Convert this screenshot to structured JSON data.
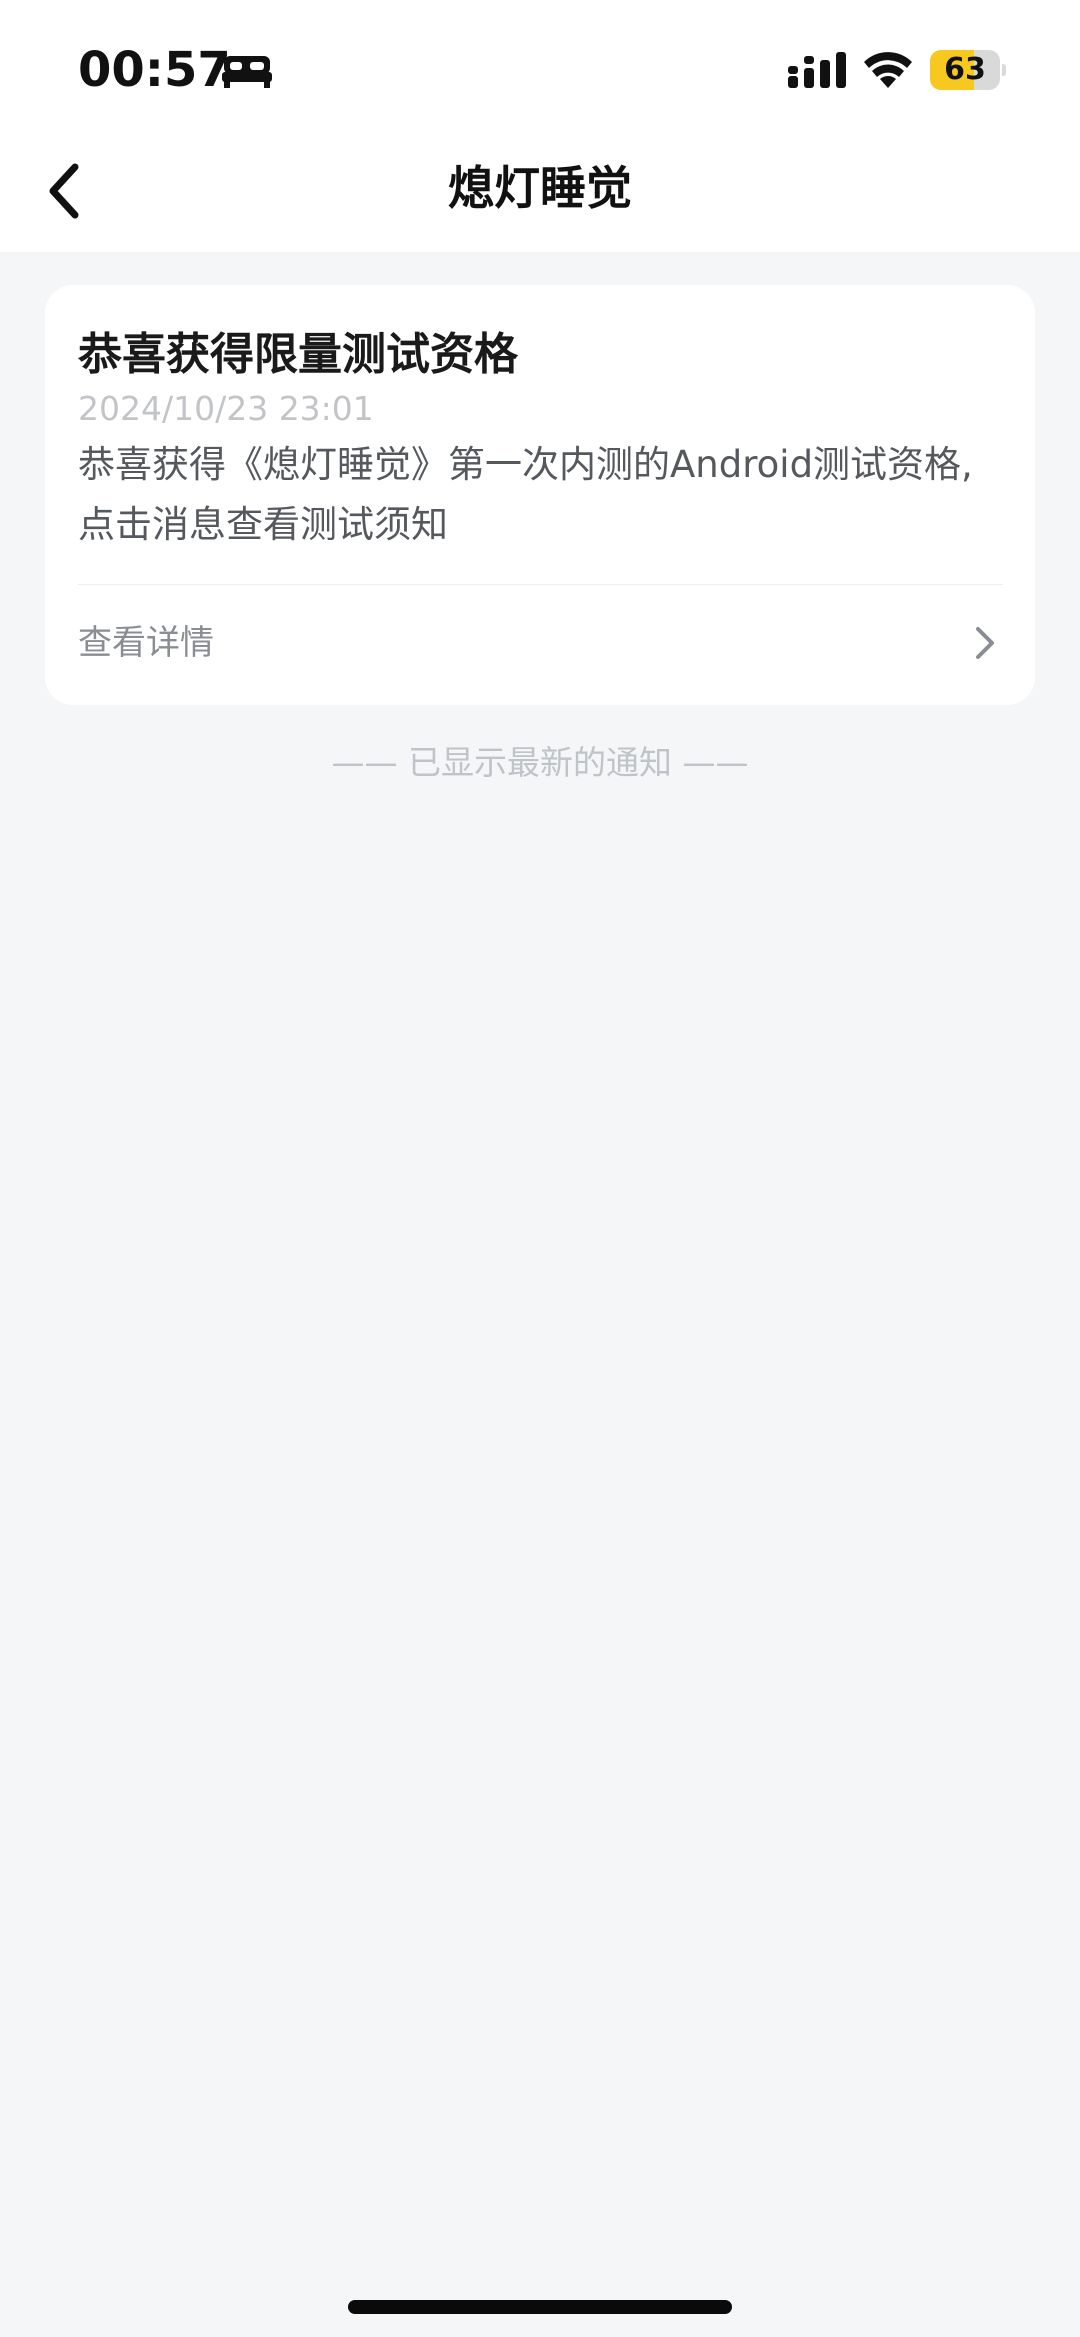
{
  "status_bar": {
    "time": "00:57",
    "battery_level": "63",
    "battery_fraction": 0.63,
    "icons": [
      "bed-icon",
      "signal-icon",
      "wifi-icon",
      "battery-icon"
    ]
  },
  "header": {
    "title": "熄灯睡觉",
    "back_icon": "chevron-left-icon"
  },
  "notification": {
    "title": "恭喜获得限量测试资格",
    "timestamp": "2024/10/23 23:01",
    "body": "恭喜获得《熄灯睡觉》第一次内测的Android测试资格,点击消息查看测试须知",
    "link_label": "查看详情",
    "link_icon": "chevron-right-icon"
  },
  "footer": {
    "note": "—— 已显示最新的通知 ——"
  },
  "colors": {
    "background": "#f5f6f8",
    "card": "#ffffff",
    "battery_fill": "#f7c81e"
  }
}
